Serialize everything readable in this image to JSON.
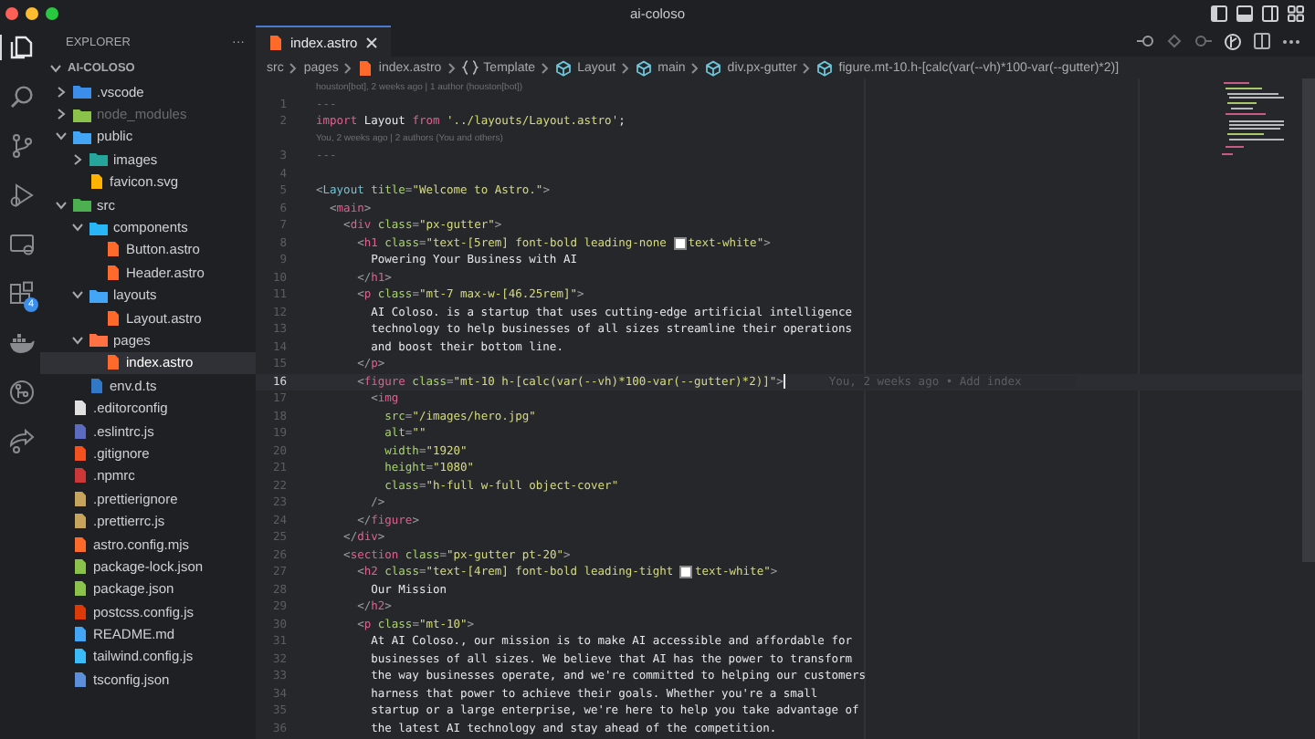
{
  "window": {
    "title": "ai-coloso"
  },
  "activity_bar": [
    {
      "kind": "files",
      "selected": true
    },
    {
      "kind": "search",
      "selected": false
    },
    {
      "kind": "source-control",
      "selected": false
    },
    {
      "kind": "run-debug",
      "selected": false
    },
    {
      "kind": "remote",
      "selected": false
    },
    {
      "kind": "extensions",
      "selected": false,
      "badge": "4"
    },
    {
      "kind": "docker",
      "selected": false
    },
    {
      "kind": "git-graph",
      "selected": false
    },
    {
      "kind": "live-share",
      "selected": false
    }
  ],
  "sidebar": {
    "title": "EXPLORER",
    "more": "···",
    "workspace": {
      "name": "AI-COLOSO",
      "expanded": true
    },
    "items": [
      {
        "name": ".vscode",
        "kind": "folder-vscode",
        "expanded": false,
        "selected": false,
        "ignored": false
      },
      {
        "name": "node_modules",
        "kind": "folder-node",
        "expanded": false,
        "selected": false,
        "ignored": true
      },
      {
        "name": "public",
        "kind": "folder-public",
        "expanded": true,
        "selected": false,
        "ignored": false,
        "children": [
          {
            "name": "images",
            "kind": "folder-images",
            "expanded": false,
            "selected": false,
            "ignored": false
          },
          {
            "name": "favicon.svg",
            "kind": "svg",
            "selected": false,
            "ignored": false
          }
        ]
      },
      {
        "name": "src",
        "kind": "folder-src",
        "expanded": true,
        "selected": false,
        "ignored": false,
        "children": [
          {
            "name": "components",
            "kind": "folder-components",
            "expanded": true,
            "selected": false,
            "ignored": false,
            "children": [
              {
                "name": "Button.astro",
                "kind": "astro",
                "selected": false,
                "ignored": false
              },
              {
                "name": "Header.astro",
                "kind": "astro",
                "selected": false,
                "ignored": false
              }
            ]
          },
          {
            "name": "layouts",
            "kind": "folder-layouts",
            "expanded": true,
            "selected": false,
            "ignored": false,
            "children": [
              {
                "name": "Layout.astro",
                "kind": "astro",
                "selected": false,
                "ignored": false
              }
            ]
          },
          {
            "name": "pages",
            "kind": "folder-pages",
            "expanded": true,
            "selected": false,
            "ignored": false,
            "children": [
              {
                "name": "index.astro",
                "kind": "astro",
                "selected": true,
                "ignored": false
              }
            ]
          },
          {
            "name": "env.d.ts",
            "kind": "ts",
            "selected": false,
            "ignored": false
          }
        ]
      },
      {
        "name": ".editorconfig",
        "kind": "editorconfig",
        "selected": false,
        "ignored": false
      },
      {
        "name": ".eslintrc.js",
        "kind": "eslint",
        "selected": false,
        "ignored": false
      },
      {
        "name": ".gitignore",
        "kind": "git",
        "selected": false,
        "ignored": false
      },
      {
        "name": ".npmrc",
        "kind": "npm",
        "selected": false,
        "ignored": false
      },
      {
        "name": ".prettierignore",
        "kind": "prettier",
        "selected": false,
        "ignored": false
      },
      {
        "name": ".prettierrc.js",
        "kind": "prettier",
        "selected": false,
        "ignored": false
      },
      {
        "name": "astro.config.mjs",
        "kind": "astro",
        "selected": false,
        "ignored": false
      },
      {
        "name": "package-lock.json",
        "kind": "json-node",
        "selected": false,
        "ignored": false
      },
      {
        "name": "package.json",
        "kind": "json-node",
        "selected": false,
        "ignored": false
      },
      {
        "name": "postcss.config.js",
        "kind": "postcss",
        "selected": false,
        "ignored": false
      },
      {
        "name": "README.md",
        "kind": "info",
        "selected": false,
        "ignored": false
      },
      {
        "name": "tailwind.config.js",
        "kind": "tailwind",
        "selected": false,
        "ignored": false
      },
      {
        "name": "tsconfig.json",
        "kind": "tsconfig",
        "selected": false,
        "ignored": false
      }
    ]
  },
  "tabs": [
    {
      "label": "index.astro",
      "selected": true
    }
  ],
  "breadcrumbs": [
    {
      "kind": "folder",
      "text": "src"
    },
    {
      "kind": "folder",
      "text": "pages"
    },
    {
      "kind": "astro",
      "text": "index.astro"
    },
    {
      "kind": "braces",
      "text": "Template"
    },
    {
      "kind": "element",
      "text": "Layout"
    },
    {
      "kind": "element",
      "text": "main"
    },
    {
      "kind": "element",
      "text": "div.px-gutter"
    },
    {
      "kind": "element",
      "text": "figure.mt-10.h-[calc(var(--vh)*100-var(--gutter)*2)]"
    }
  ],
  "code": {
    "lines": [
      {
        "kind": "blame",
        "text": "houston[bot], 2 weeks ago | 1 author (houston[bot])"
      },
      {
        "kind": "code",
        "n": "1",
        "current": false,
        "segments": [
          {
            "kind": "dim",
            "text": "---"
          }
        ]
      },
      {
        "kind": "code",
        "n": "2",
        "current": false,
        "segments": [
          {
            "kind": "keyword",
            "text": "import"
          },
          {
            "kind": "text",
            "text": " Layout "
          },
          {
            "kind": "keyword",
            "text": "from"
          },
          {
            "kind": "string",
            "text": " '../layouts/Layout.astro'"
          },
          {
            "kind": "text",
            "text": ";"
          }
        ]
      },
      {
        "kind": "blame",
        "text": "You, 2 weeks ago | 2 authors (You and others)"
      },
      {
        "kind": "code",
        "n": "3",
        "current": false,
        "segments": [
          {
            "kind": "dim",
            "text": "---"
          }
        ]
      },
      {
        "kind": "code",
        "n": "4",
        "current": false
      },
      {
        "kind": "code",
        "n": "5",
        "current": false,
        "segments": [
          {
            "kind": "punct",
            "text": "<"
          },
          {
            "kind": "component",
            "text": "Layout"
          },
          {
            "kind": "attr",
            "text": " title"
          },
          {
            "kind": "punct",
            "text": "="
          },
          {
            "kind": "string",
            "text": "\"Welcome to Astro.\""
          },
          {
            "kind": "punct",
            "text": ">"
          }
        ]
      },
      {
        "kind": "code",
        "n": "6",
        "current": false,
        "segments": [
          {
            "kind": "punct",
            "text": "  <"
          },
          {
            "kind": "tag",
            "text": "main"
          },
          {
            "kind": "punct",
            "text": ">"
          }
        ]
      },
      {
        "kind": "code",
        "n": "7",
        "current": false,
        "segments": [
          {
            "kind": "punct",
            "text": "    <"
          },
          {
            "kind": "tag",
            "text": "div"
          },
          {
            "kind": "attr",
            "text": " class"
          },
          {
            "kind": "punct",
            "text": "="
          },
          {
            "kind": "string",
            "text": "\"px-gutter\""
          },
          {
            "kind": "punct",
            "text": ">"
          }
        ]
      },
      {
        "kind": "code",
        "n": "8",
        "current": false,
        "segments": [
          {
            "kind": "punct",
            "text": "      <"
          },
          {
            "kind": "tag",
            "text": "h1"
          },
          {
            "kind": "attr",
            "text": " class"
          },
          {
            "kind": "punct",
            "text": "="
          },
          {
            "kind": "string",
            "text": "\"text-[5rem] font-bold leading-none "
          },
          {
            "kind": "swatch",
            "color": "#ffffff"
          },
          {
            "kind": "string",
            "text": "text-white\""
          },
          {
            "kind": "punct",
            "text": ">"
          }
        ]
      },
      {
        "kind": "code",
        "n": "9",
        "current": false,
        "segments": [
          {
            "kind": "text",
            "text": "        Powering Your Business with AI"
          }
        ]
      },
      {
        "kind": "code",
        "n": "10",
        "current": false,
        "segments": [
          {
            "kind": "punct",
            "text": "      </"
          },
          {
            "kind": "tag",
            "text": "h1"
          },
          {
            "kind": "punct",
            "text": ">"
          }
        ]
      },
      {
        "kind": "code",
        "n": "11",
        "current": false,
        "segments": [
          {
            "kind": "punct",
            "text": "      <"
          },
          {
            "kind": "tag",
            "text": "p"
          },
          {
            "kind": "attr",
            "text": " class"
          },
          {
            "kind": "punct",
            "text": "="
          },
          {
            "kind": "string",
            "text": "\"mt-7 max-w-[46.25rem]\""
          },
          {
            "kind": "punct",
            "text": ">"
          }
        ]
      },
      {
        "kind": "code",
        "n": "12",
        "current": false,
        "segments": [
          {
            "kind": "text",
            "text": "        AI Coloso. is a startup that uses cutting-edge artificial intelligence"
          }
        ]
      },
      {
        "kind": "code",
        "n": "13",
        "current": false,
        "segments": [
          {
            "kind": "text",
            "text": "        technology to help businesses of all sizes streamline their operations"
          }
        ]
      },
      {
        "kind": "code",
        "n": "14",
        "current": false,
        "segments": [
          {
            "kind": "text",
            "text": "        and boost their bottom line."
          }
        ]
      },
      {
        "kind": "code",
        "n": "15",
        "current": false,
        "segments": [
          {
            "kind": "punct",
            "text": "      </"
          },
          {
            "kind": "tag",
            "text": "p"
          },
          {
            "kind": "punct",
            "text": ">"
          }
        ]
      },
      {
        "kind": "code",
        "n": "16",
        "current": true,
        "inline_blame": "You, 2 weeks ago • Add index",
        "segments": [
          {
            "kind": "punct",
            "text": "      <"
          },
          {
            "kind": "tag",
            "text": "figure"
          },
          {
            "kind": "attr",
            "text": " class"
          },
          {
            "kind": "punct",
            "text": "="
          },
          {
            "kind": "string",
            "text": "\"mt-10 h-[calc(var(--vh)*100-var(--gutter)*2)]\""
          },
          {
            "kind": "punct",
            "text": ">"
          }
        ]
      },
      {
        "kind": "code",
        "n": "17",
        "current": false,
        "segments": [
          {
            "kind": "punct",
            "text": "        <"
          },
          {
            "kind": "tag",
            "text": "img"
          }
        ]
      },
      {
        "kind": "code",
        "n": "18",
        "current": false,
        "segments": [
          {
            "kind": "attr",
            "text": "          src"
          },
          {
            "kind": "punct",
            "text": "="
          },
          {
            "kind": "string",
            "text": "\"/images/hero.jpg\""
          }
        ]
      },
      {
        "kind": "code",
        "n": "19",
        "current": false,
        "segments": [
          {
            "kind": "attr",
            "text": "          alt"
          },
          {
            "kind": "punct",
            "text": "="
          },
          {
            "kind": "string",
            "text": "\"\""
          }
        ]
      },
      {
        "kind": "code",
        "n": "20",
        "current": false,
        "segments": [
          {
            "kind": "attr",
            "text": "          width"
          },
          {
            "kind": "punct",
            "text": "="
          },
          {
            "kind": "string",
            "text": "\"1920\""
          }
        ]
      },
      {
        "kind": "code",
        "n": "21",
        "current": false,
        "segments": [
          {
            "kind": "attr",
            "text": "          height"
          },
          {
            "kind": "punct",
            "text": "="
          },
          {
            "kind": "string",
            "text": "\"1080\""
          }
        ]
      },
      {
        "kind": "code",
        "n": "22",
        "current": false,
        "segments": [
          {
            "kind": "attr",
            "text": "          class"
          },
          {
            "kind": "punct",
            "text": "="
          },
          {
            "kind": "string",
            "text": "\"h-full w-full object-cover\""
          }
        ]
      },
      {
        "kind": "code",
        "n": "23",
        "current": false,
        "segments": [
          {
            "kind": "punct",
            "text": "        />"
          }
        ]
      },
      {
        "kind": "code",
        "n": "24",
        "current": false,
        "segments": [
          {
            "kind": "punct",
            "text": "      </"
          },
          {
            "kind": "tag",
            "text": "figure"
          },
          {
            "kind": "punct",
            "text": ">"
          }
        ]
      },
      {
        "kind": "code",
        "n": "25",
        "current": false,
        "segments": [
          {
            "kind": "punct",
            "text": "    </"
          },
          {
            "kind": "tag",
            "text": "div"
          },
          {
            "kind": "punct",
            "text": ">"
          }
        ]
      },
      {
        "kind": "code",
        "n": "26",
        "current": false,
        "segments": [
          {
            "kind": "punct",
            "text": "    <"
          },
          {
            "kind": "tag",
            "text": "section"
          },
          {
            "kind": "attr",
            "text": " class"
          },
          {
            "kind": "punct",
            "text": "="
          },
          {
            "kind": "string",
            "text": "\"px-gutter pt-20\""
          },
          {
            "kind": "punct",
            "text": ">"
          }
        ]
      },
      {
        "kind": "code",
        "n": "27",
        "current": false,
        "segments": [
          {
            "kind": "punct",
            "text": "      <"
          },
          {
            "kind": "tag",
            "text": "h2"
          },
          {
            "kind": "attr",
            "text": " class"
          },
          {
            "kind": "punct",
            "text": "="
          },
          {
            "kind": "string",
            "text": "\"text-[4rem] font-bold leading-tight "
          },
          {
            "kind": "swatch",
            "color": "#ffffff"
          },
          {
            "kind": "string",
            "text": "text-white\""
          },
          {
            "kind": "punct",
            "text": ">"
          }
        ]
      },
      {
        "kind": "code",
        "n": "28",
        "current": false,
        "segments": [
          {
            "kind": "text",
            "text": "        Our Mission"
          }
        ]
      },
      {
        "kind": "code",
        "n": "29",
        "current": false,
        "segments": [
          {
            "kind": "punct",
            "text": "      </"
          },
          {
            "kind": "tag",
            "text": "h2"
          },
          {
            "kind": "punct",
            "text": ">"
          }
        ]
      },
      {
        "kind": "code",
        "n": "30",
        "current": false,
        "segments": [
          {
            "kind": "punct",
            "text": "      <"
          },
          {
            "kind": "tag",
            "text": "p"
          },
          {
            "kind": "attr",
            "text": " class"
          },
          {
            "kind": "punct",
            "text": "="
          },
          {
            "kind": "string",
            "text": "\"mt-10\""
          },
          {
            "kind": "punct",
            "text": ">"
          }
        ]
      },
      {
        "kind": "code",
        "n": "31",
        "current": false,
        "segments": [
          {
            "kind": "text",
            "text": "        At AI Coloso., our mission is to make AI accessible and affordable for"
          }
        ]
      },
      {
        "kind": "code",
        "n": "32",
        "current": false,
        "segments": [
          {
            "kind": "text",
            "text": "        businesses of all sizes. We believe that AI has the power to transform"
          }
        ]
      },
      {
        "kind": "code",
        "n": "33",
        "current": false,
        "segments": [
          {
            "kind": "text",
            "text": "        the way businesses operate, and we're committed to helping our customers"
          }
        ]
      },
      {
        "kind": "code",
        "n": "34",
        "current": false,
        "segments": [
          {
            "kind": "text",
            "text": "        harness that power to achieve their goals. Whether you're a small"
          }
        ]
      },
      {
        "kind": "code",
        "n": "35",
        "current": false,
        "segments": [
          {
            "kind": "text",
            "text": "        startup or a large enterprise, we're here to help you take advantage of"
          }
        ]
      },
      {
        "kind": "code",
        "n": "36",
        "current": false,
        "segments": [
          {
            "kind": "text",
            "text": "        the latest AI technology and stay ahead of the competition."
          }
        ]
      }
    ]
  }
}
